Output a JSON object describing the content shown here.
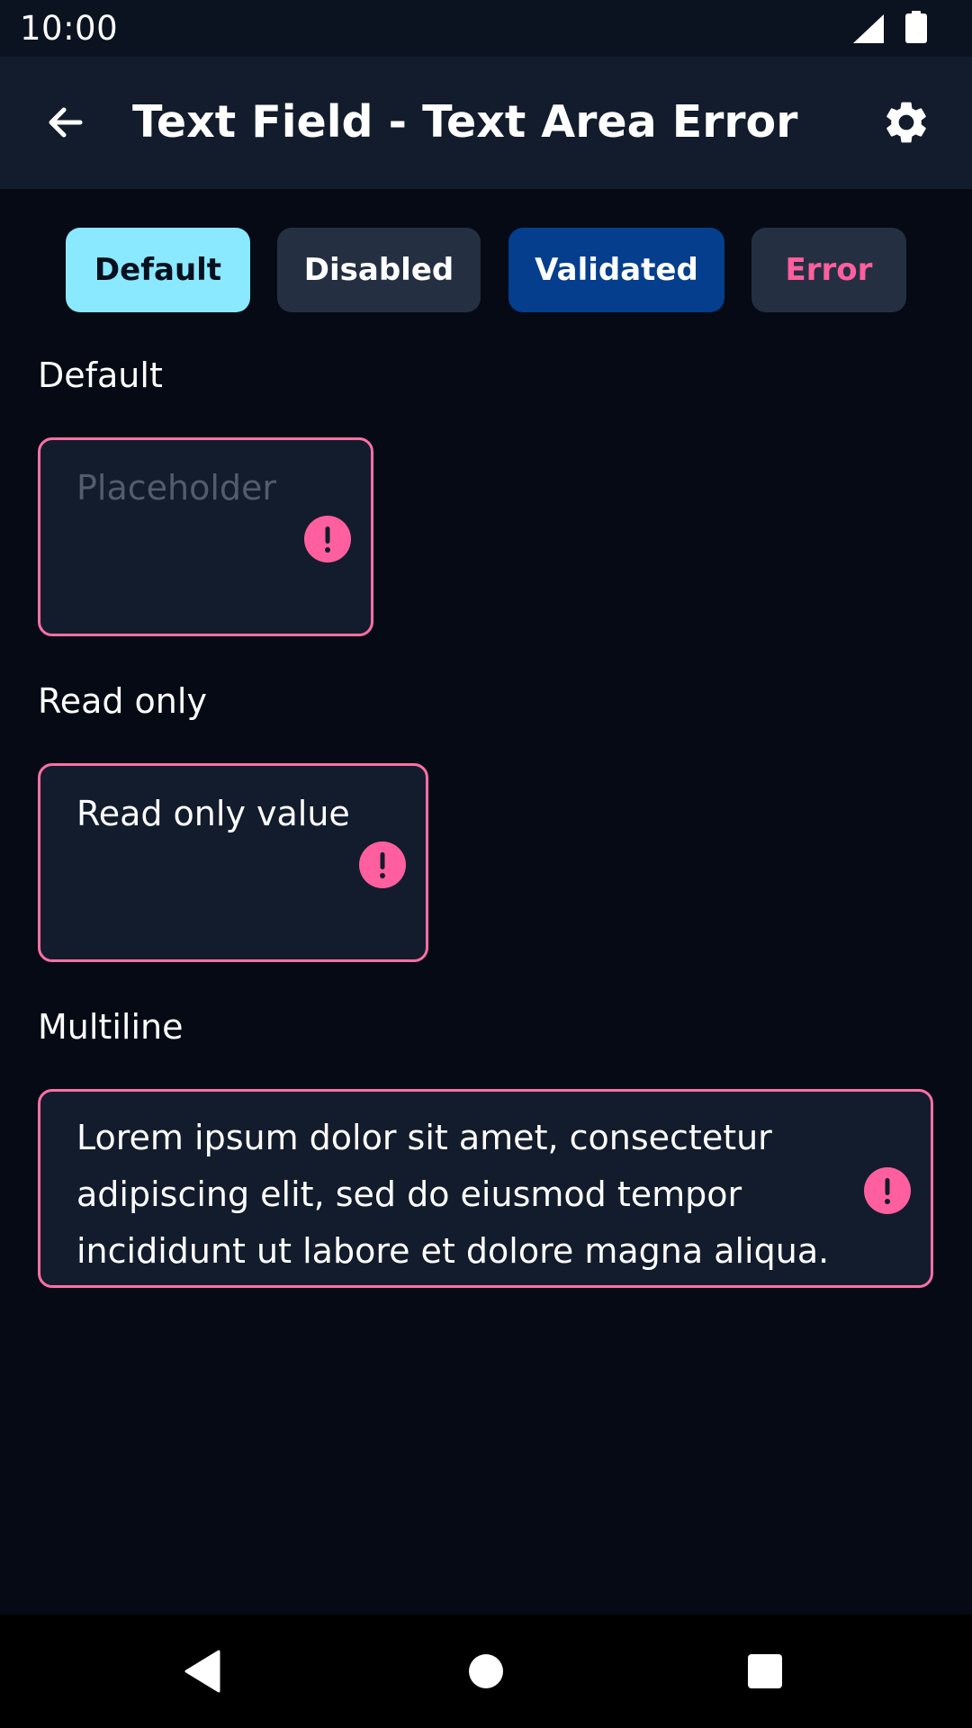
{
  "status_bar": {
    "time": "10:00",
    "signal_icon": "signal-icon",
    "battery_icon": "battery-icon"
  },
  "app_bar": {
    "back_icon": "arrow-left-icon",
    "title": "Text Field - Text Area Error",
    "settings_icon": "gear-icon"
  },
  "chips": [
    {
      "label": "Default",
      "selected": true
    },
    {
      "label": "Disabled",
      "selected": false
    },
    {
      "label": "Validated",
      "selected": false
    },
    {
      "label": "Error",
      "selected": false
    }
  ],
  "sections": [
    {
      "label": "Default",
      "field": {
        "value": "",
        "placeholder": "Placeholder",
        "state": "error"
      }
    },
    {
      "label": "Read only",
      "field": {
        "value": "Read only value",
        "state": "error"
      }
    },
    {
      "label": "Multiline",
      "field": {
        "value": "Lorem ipsum dolor sit amet, consectetur adipiscing elit, sed do eiusmod tempor incididunt ut labore et dolore magna aliqua.",
        "state": "error"
      }
    }
  ],
  "colors": {
    "background": "#050a14",
    "app_bar": "#131c2c",
    "field_background": "#131c2c",
    "error": "#ff5f9e",
    "chip_default": "#8ae8ff",
    "chip_validated": "#043e8c",
    "chip_neutral": "#243042"
  },
  "nav_bar": {
    "back_icon": "nav-back-triangle-icon",
    "home_icon": "nav-home-circle-icon",
    "recents_icon": "nav-recents-square-icon"
  }
}
